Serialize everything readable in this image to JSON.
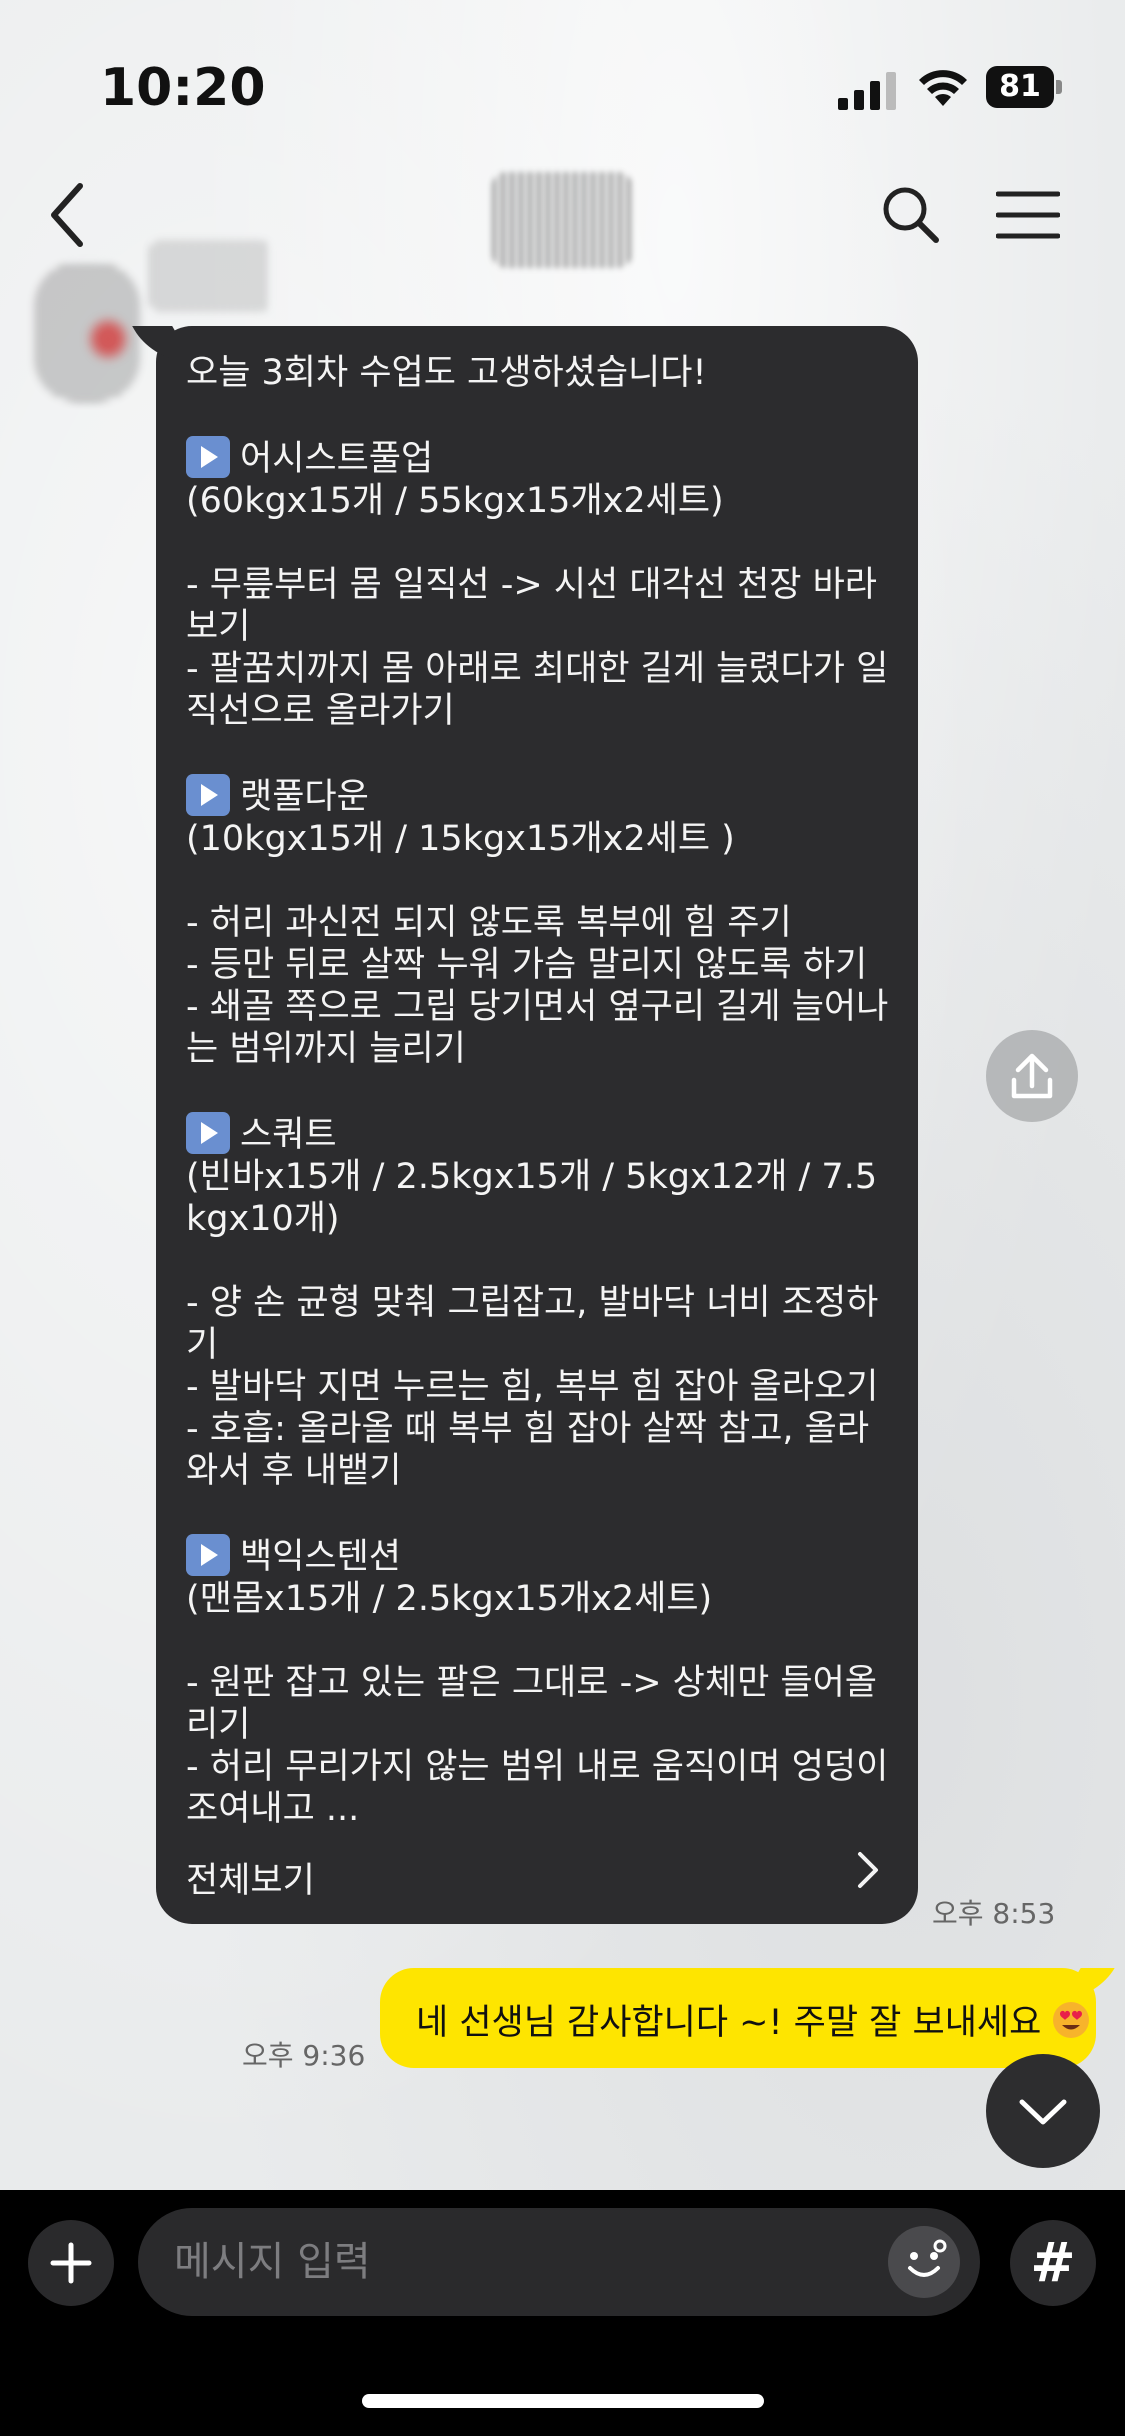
{
  "status_bar": {
    "time": "10:20",
    "battery": "81"
  },
  "header": {
    "title": ""
  },
  "messages": {
    "received": {
      "text": "오늘 3회차 수업도 고생하셨습니다!\n\n|▶|어시스트풀업\n(60kgx15개 / 55kgx15개x2세트)\n\n- 무릎부터 몸 일직선 -> 시선 대각선 천장 바라보기\n- 팔꿈치까지 몸 아래로 최대한 길게 늘렸다가 일직선으로 올라가기\n\n|▶|랫풀다운\n(10kgx15개 / 15kgx15개x2세트 )\n\n- 허리 과신전 되지 않도록 복부에 힘 주기\n- 등만 뒤로 살짝 누워 가슴 말리지 않도록 하기\n- 쇄골 쪽으로 그립 당기면서 옆구리 길게 늘어나는 범위까지 늘리기\n\n|▶|스쿼트\n(빈바x15개 / 2.5kgx15개 / 5kgx12개 / 7.5kgx10개)\n\n- 양 손 균형 맞춰 그립잡고, 발바닥 너비 조정하기\n- 발바닥 지면 누르는 힘, 복부 힘 잡아 올라오기\n- 호흡: 올라올 때 복부 힘 잡아 살짝 참고, 올라와서 후 내뱉기\n\n|▶|백익스텐션\n(맨몸x15개 / 2.5kgx15개x2세트)\n\n- 원판 잡고 있는 팔은 그대로 -> 상체만 들어올리기\n- 허리 무리가지 않는 범위 내로 움직이며 엉덩이 조여내고 ...",
      "view_all": "전체보기",
      "time": "오후 8:53"
    },
    "sent": {
      "text": "네 선생님 감사합니다 ~! 주말 잘 보내세요",
      "emoji": "smiling-face-heart-eyes",
      "time": "오후 9:36"
    }
  },
  "input": {
    "placeholder": "메시지 입력",
    "value": ""
  },
  "bottom_bar": {
    "hash_label": "#"
  },
  "colors": {
    "received_bubble": "#2c2c2e",
    "sent_bubble": "#fee500",
    "bottom_bar": "#000000"
  }
}
